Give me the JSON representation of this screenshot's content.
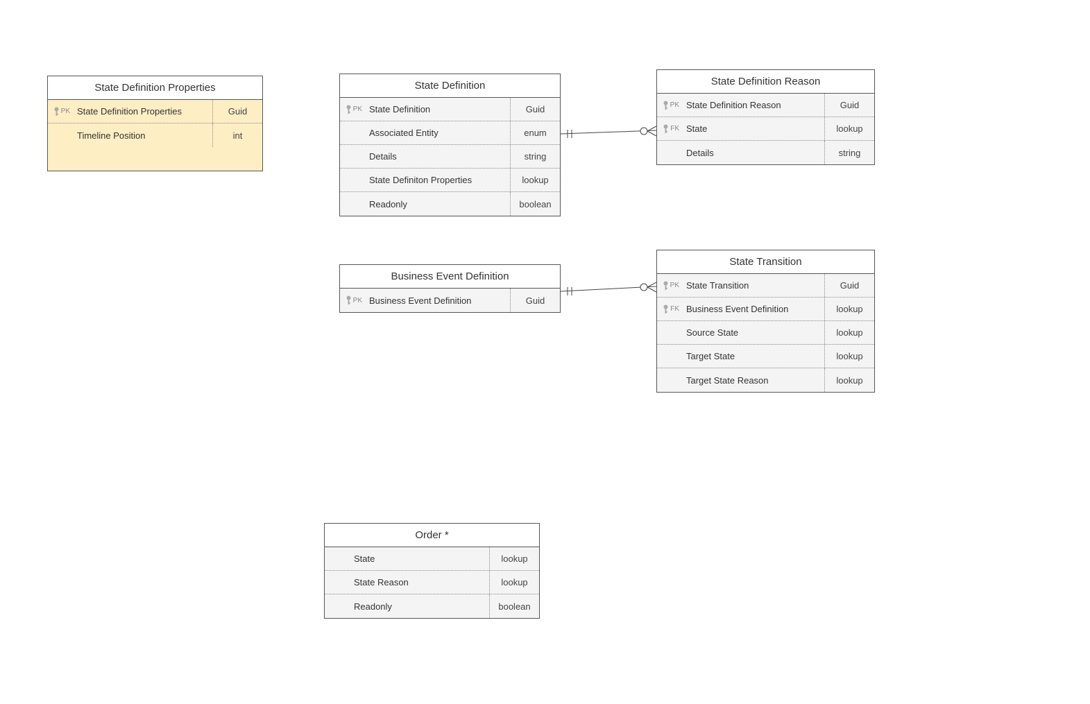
{
  "entities": {
    "sdp": {
      "title": "State Definition Properties",
      "rows": [
        {
          "keyLabel": "PK",
          "hasIcon": true,
          "name": "State Definition Properties",
          "type": "Guid"
        },
        {
          "keyLabel": "",
          "hasIcon": false,
          "name": "Timeline Position",
          "type": "int"
        }
      ]
    },
    "sd": {
      "title": "State Definition",
      "rows": [
        {
          "keyLabel": "PK",
          "hasIcon": true,
          "name": "State Definition",
          "type": "Guid"
        },
        {
          "keyLabel": "",
          "hasIcon": false,
          "name": "Associated Entity",
          "type": "enum"
        },
        {
          "keyLabel": "",
          "hasIcon": false,
          "name": "Details",
          "type": "string"
        },
        {
          "keyLabel": "",
          "hasIcon": false,
          "name": "State Definiton Properties",
          "type": "lookup"
        },
        {
          "keyLabel": "",
          "hasIcon": false,
          "name": "Readonly",
          "type": "boolean"
        }
      ]
    },
    "sdr": {
      "title": "State Definition Reason",
      "rows": [
        {
          "keyLabel": "PK",
          "hasIcon": true,
          "name": "State Definition Reason",
          "type": "Guid"
        },
        {
          "keyLabel": "FK",
          "hasIcon": true,
          "name": "State",
          "type": "lookup"
        },
        {
          "keyLabel": "",
          "hasIcon": false,
          "name": "Details",
          "type": "string"
        }
      ]
    },
    "bed": {
      "title": "Business Event Definition",
      "rows": [
        {
          "keyLabel": "PK",
          "hasIcon": true,
          "name": "Business Event Definition",
          "type": "Guid"
        }
      ]
    },
    "st": {
      "title": "State Transition",
      "rows": [
        {
          "keyLabel": "PK",
          "hasIcon": true,
          "name": "State Transition",
          "type": "Guid"
        },
        {
          "keyLabel": "FK",
          "hasIcon": true,
          "name": "Business Event Definition",
          "type": "lookup"
        },
        {
          "keyLabel": "",
          "hasIcon": false,
          "name": "Source State",
          "type": "lookup"
        },
        {
          "keyLabel": "",
          "hasIcon": false,
          "name": "Target State",
          "type": "lookup"
        },
        {
          "keyLabel": "",
          "hasIcon": false,
          "name": "Target State Reason",
          "type": "lookup"
        }
      ]
    },
    "order": {
      "title": "Order *",
      "rows": [
        {
          "keyLabel": "",
          "hasIcon": false,
          "name": "State",
          "type": "lookup"
        },
        {
          "keyLabel": "",
          "hasIcon": false,
          "name": "State Reason",
          "type": "lookup"
        },
        {
          "keyLabel": "",
          "hasIcon": false,
          "name": "Readonly",
          "type": "boolean"
        }
      ]
    }
  }
}
